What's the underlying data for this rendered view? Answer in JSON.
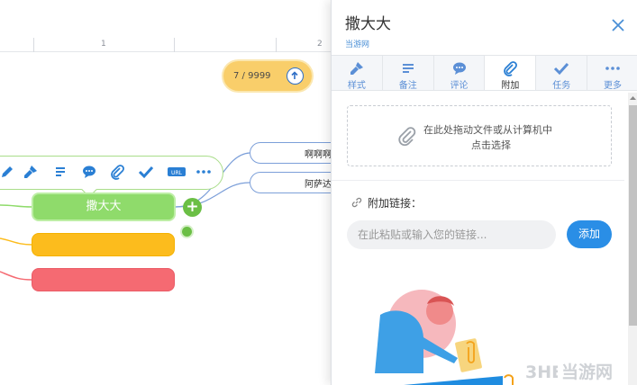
{
  "ruler": {
    "labels": [
      "1",
      "2"
    ]
  },
  "page_counter": {
    "text": "7 / 9999"
  },
  "nodes": {
    "main": "撒大大",
    "sub1": "啊啊啊",
    "sub2": "阿萨达"
  },
  "node_toolbar": {
    "icons": [
      "edit-icon",
      "brush-icon",
      "notes-icon",
      "comment-icon",
      "attach-icon",
      "task-icon",
      "hyperlink-icon",
      "more-icon"
    ]
  },
  "panel": {
    "title": "撒大大",
    "subtitle": "当游网",
    "tabs": [
      {
        "label": "样式",
        "icon": "brush-icon"
      },
      {
        "label": "备注",
        "icon": "notes-icon"
      },
      {
        "label": "评论",
        "icon": "comment-icon"
      },
      {
        "label": "附加",
        "icon": "attach-icon",
        "active": true
      },
      {
        "label": "任务",
        "icon": "check-icon"
      },
      {
        "label": "更多",
        "icon": "more-icon"
      }
    ],
    "drop_zone": {
      "line1": "在此处拖动文件或从计算机中",
      "line2": "点击选择"
    },
    "link": {
      "label": "附加链接：",
      "placeholder": "在此粘贴或输入您的链接...",
      "button": "添加"
    }
  },
  "watermark": {
    "text": "当游网"
  },
  "colors": {
    "accent": "#2a8ee6",
    "node_green": "#8fdb6b",
    "node_yellow": "#fcbc1d",
    "node_red": "#f56a72",
    "pill": "#f9ce6a"
  }
}
